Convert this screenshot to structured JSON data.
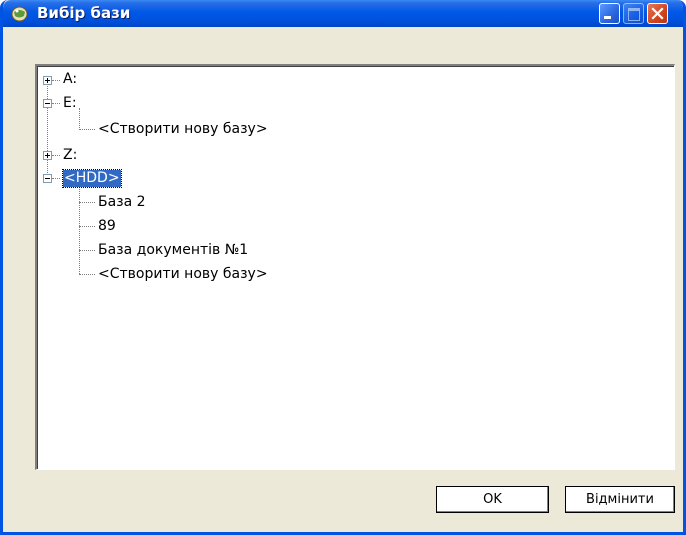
{
  "window": {
    "title": "Вибір бази"
  },
  "tree": {
    "drive_a": "A:",
    "drive_e": "E:",
    "e_create_new": "<Створити нову базу>",
    "drive_z": "Z:",
    "hdd": "<HDD>",
    "hdd_children": [
      "База 2",
      "89",
      "База документів №1",
      "<Створити нову базу>"
    ]
  },
  "buttons": {
    "ok": "OK",
    "cancel": "Відмінити"
  }
}
